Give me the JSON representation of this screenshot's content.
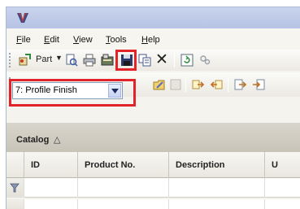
{
  "menu": {
    "items": [
      "File",
      "Edit",
      "View",
      "Tools",
      "Help"
    ]
  },
  "toolbar": {
    "part_label": "Part",
    "save_tooltip": "Save",
    "delete_glyph": "✕"
  },
  "view_selector": {
    "value": "7: Profile Finish"
  },
  "grid": {
    "group_label": "Catalog",
    "sort_glyph": "△",
    "columns": [
      "ID",
      "Product No.",
      "Description",
      "U"
    ]
  },
  "colors": {
    "highlight": "#e1242a",
    "titlebar": "#b7c3e4"
  }
}
